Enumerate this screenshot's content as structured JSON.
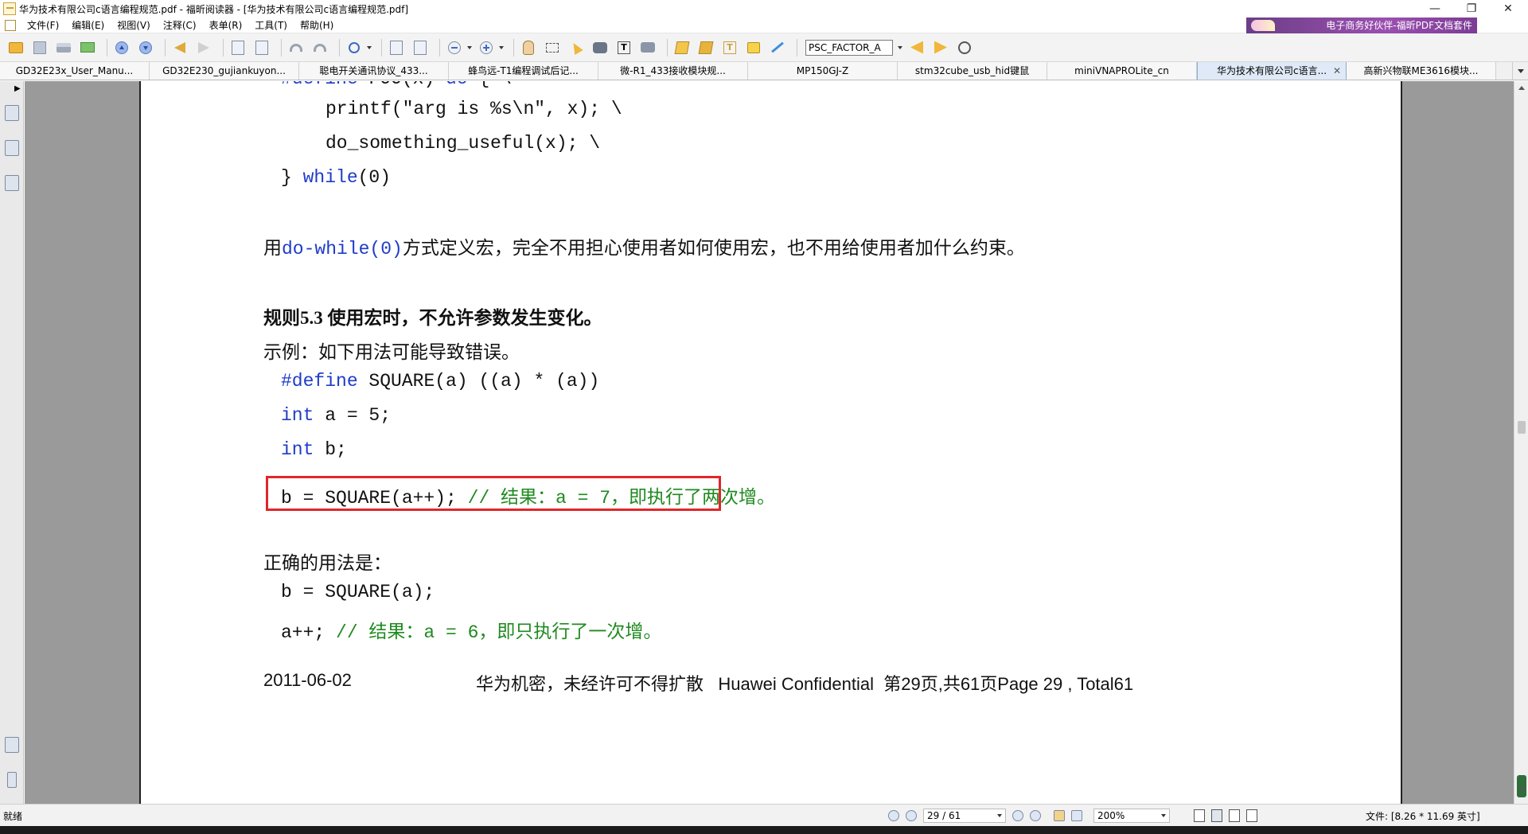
{
  "window": {
    "title": "华为技术有限公司c语言编程规范.pdf - 福昕阅读器 - [华为技术有限公司c语言编程规范.pdf]",
    "controls": [
      "—",
      "❐",
      "✕"
    ]
  },
  "menu": {
    "items": [
      "文件(F)",
      "编辑(E)",
      "视图(V)",
      "注释(C)",
      "表单(R)",
      "工具(T)",
      "帮助(H)"
    ],
    "banner": "电子商务好伙伴-福昕PDF文档套件"
  },
  "toolbar": {
    "search_value": "PSC_FACTOR_A",
    "icons": [
      "open-icon",
      "save-icon",
      "print-icon",
      "email-icon",
      "prev-page-icon",
      "next-page-icon",
      "back-icon",
      "forward-icon",
      "extract-pages-icon",
      "insert-pages-icon",
      "undo-icon",
      "redo-icon",
      "zoom-icon",
      "zoom-out-icon",
      "zoom-in-icon",
      "hand-icon",
      "select-text-icon",
      "select-arrow-icon",
      "find-icon",
      "typewriter-icon",
      "snapshot-icon",
      "highlight-icon",
      "pen-icon",
      "textbox-icon",
      "note-icon",
      "arrow-tool-icon"
    ]
  },
  "tabs": [
    {
      "label": "GD32E23x_User_Manu...",
      "active": false
    },
    {
      "label": "GD32E230_gujiankuyon...",
      "active": false
    },
    {
      "label": "聪电开关通讯协议_433...",
      "active": false
    },
    {
      "label": "蜂鸟远-T1编程调试后记...",
      "active": false
    },
    {
      "label": "微-R1_433接收模块规...",
      "active": false
    },
    {
      "label": "MP150GJ-Z",
      "active": false
    },
    {
      "label": "stm32cube_usb_hid键鼠",
      "active": false
    },
    {
      "label": "miniVNAPROLite_cn",
      "active": false
    },
    {
      "label": "华为技术有限公司c语言...",
      "active": true
    },
    {
      "label": "高新兴物联ME3616模块...",
      "active": false
    }
  ],
  "document": {
    "code1": {
      "line1_kw": "#define",
      "line1_rest": " FOO(x) ",
      "line1_kw2": "do",
      "line1_tail": " { \\",
      "line2": "printf(\"arg is %s\\n\", x); \\",
      "line3": "do_something_useful(x); \\",
      "line4_pre": "} ",
      "line4_kw": "while",
      "line4_rest": "(0)"
    },
    "para1_pre": "用",
    "para1_code": "do-while(0)",
    "para1_post": "方式定义宏，完全不用担心使用者如何使用宏，也不用给使用者加什么约束。",
    "rule_title": "规则5.3 使用宏时，不允许参数发生变化。",
    "example_label": "示例：如下用法可能导致错误。",
    "code2": {
      "line1_kw": "#define",
      "line1_rest": " SQUARE(a) ((a) * (a))",
      "line2_kw": "int",
      "line2_rest": " a = 5;",
      "line3_kw": "int",
      "line3_rest": " b;",
      "line4_code": "b = SQUARE(a++); ",
      "line4_comment": "// 结果：a = 7，即执行了两次增。"
    },
    "correct_label": "正确的用法是：",
    "code3": {
      "line1": "b = SQUARE(a);",
      "line2_code": "a++; ",
      "line2_comment": "// 结果：a = 6，即只执行了一次增。"
    },
    "footer_date": "2011-06-02",
    "footer_confidential": "华为机密，未经许可不得扩散   Huawei Confidential  第29页,共61页Page 29 , Total61"
  },
  "statusbar": {
    "status": "就绪",
    "page_value": "29 / 61",
    "zoom_value": "200%",
    "file_size": "文件: [8.26 * 11.69 英寸]"
  },
  "colors": {
    "keyword": "#1f3cc8",
    "comment": "#1f8a1f",
    "highlight_border": "#e0262a",
    "page_background": "#9a9a9a"
  }
}
